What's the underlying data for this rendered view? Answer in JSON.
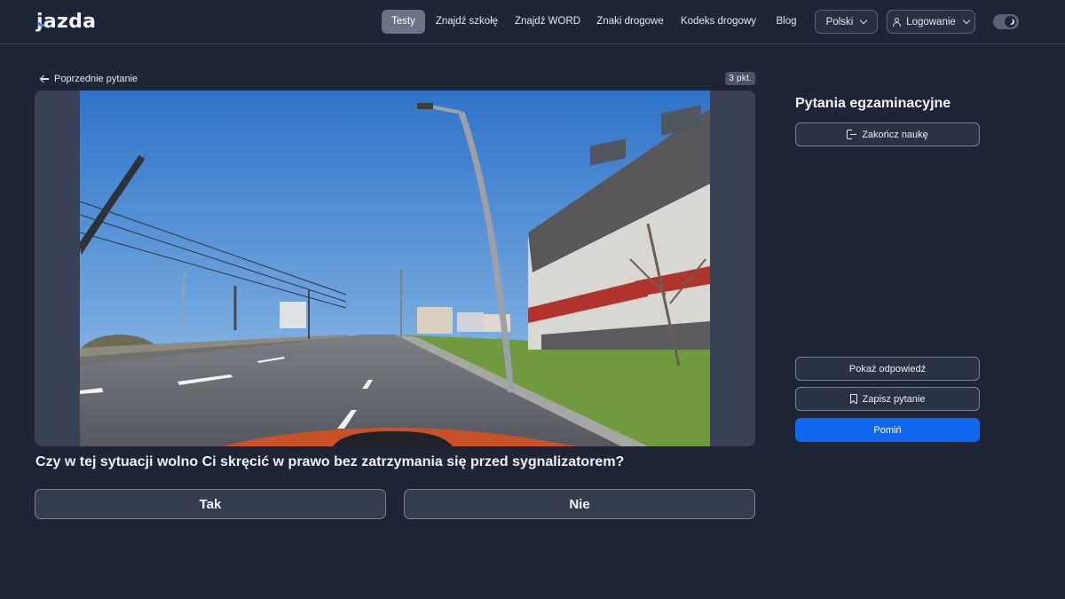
{
  "header": {
    "logo": "jazda",
    "nav": [
      {
        "label": "Testy",
        "active": true
      },
      {
        "label": "Znajdź szkołę"
      },
      {
        "label": "Znajdź WORD"
      },
      {
        "label": "Znaki drogowe"
      },
      {
        "label": "Kodeks drogowy"
      },
      {
        "label": "Blog"
      }
    ],
    "language": "Polski",
    "login": "Logowanie",
    "theme_toggle_icon": "moon-icon"
  },
  "question": {
    "back_label": "Poprzednie pytanie",
    "points": "3 pkt.",
    "text": "Czy w tej sytuacji wolno Ci skręcić w prawo bez zatrzymania się przed sygnalizatorem?",
    "answers": [
      "Tak",
      "Nie"
    ]
  },
  "sidebar": {
    "title": "Pytania egzaminacyjne",
    "finish_label": "Zakończ naukę",
    "show_answer_label": "Pokaż odpowiedź",
    "save_label": "Zapisz pytanie",
    "skip_label": "Pomiń"
  },
  "colors": {
    "background": "#1e2536",
    "accent": "#1168f0",
    "nav_active": "#6b7487"
  }
}
